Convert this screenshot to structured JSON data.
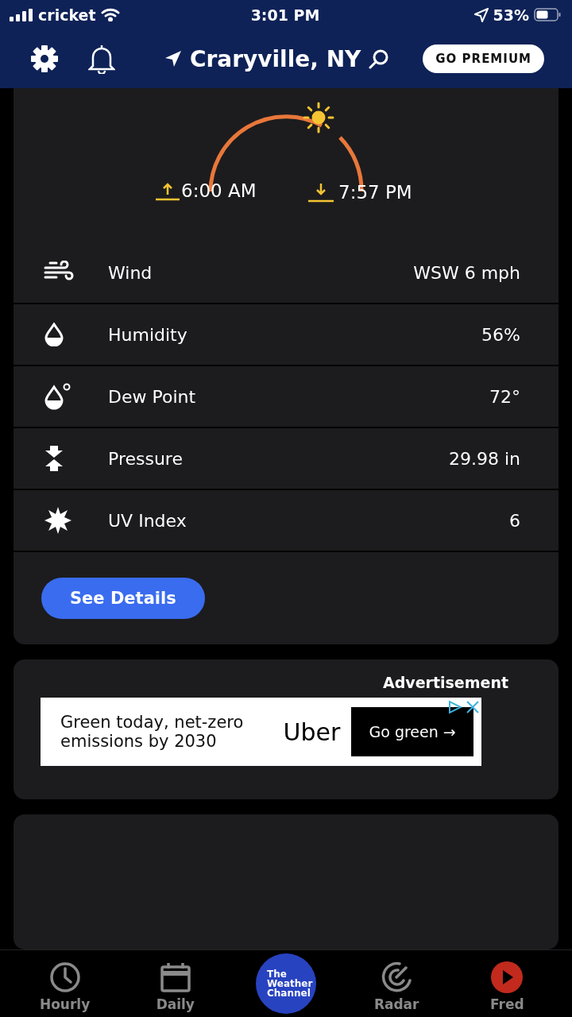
{
  "status_bar": {
    "carrier": "cricket",
    "time": "3:01 PM",
    "battery": "53%"
  },
  "header": {
    "location": "Craryville, NY",
    "premium_button": "GO PREMIUM"
  },
  "sun": {
    "sunrise": "6:00 AM",
    "sunset": "7:57 PM"
  },
  "conditions": [
    {
      "kind": "wind",
      "label": "Wind",
      "value": "WSW 6 mph"
    },
    {
      "kind": "humidity",
      "label": "Humidity",
      "value": "56%"
    },
    {
      "kind": "dew",
      "label": "Dew Point",
      "value": "72°"
    },
    {
      "kind": "pressure",
      "label": "Pressure",
      "value": "29.98 in"
    },
    {
      "kind": "uv",
      "label": "UV Index",
      "value": "6"
    }
  ],
  "details_button": "See Details",
  "ad": {
    "label": "Advertisement",
    "text": "Green today, net-zero emissions by 2030",
    "brand": "Uber",
    "cta": "Go green →"
  },
  "tabs": [
    {
      "kind": "hourly",
      "label": "Hourly"
    },
    {
      "kind": "daily",
      "label": "Daily"
    },
    {
      "kind": "logo",
      "label": "The Weather Channel"
    },
    {
      "kind": "radar",
      "label": "Radar"
    },
    {
      "kind": "video",
      "label": "Fred"
    }
  ]
}
